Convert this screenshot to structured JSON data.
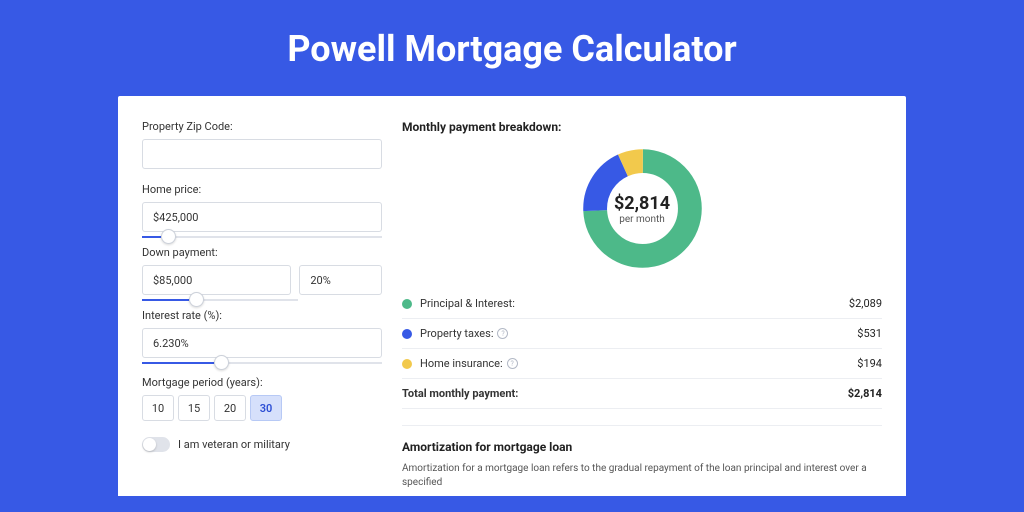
{
  "title": "Powell Mortgage Calculator",
  "form": {
    "zip_label": "Property Zip Code:",
    "zip_value": "",
    "home_price_label": "Home price:",
    "home_price_value": "$425,000",
    "down_payment_label": "Down payment:",
    "down_payment_value": "$85,000",
    "down_payment_pct": "20%",
    "interest_label": "Interest rate (%):",
    "interest_value": "6.230%",
    "period_label": "Mortgage period (years):",
    "periods": [
      "10",
      "15",
      "20",
      "30"
    ],
    "period_active": "30",
    "veteran_label": "I am veteran or military"
  },
  "breakdown": {
    "title": "Monthly payment breakdown:",
    "total_amount": "$2,814",
    "total_sub": "per month",
    "rows": [
      {
        "label": "Principal & Interest:",
        "value": "$2,089",
        "color": "pi"
      },
      {
        "label": "Property taxes:",
        "value": "$531",
        "color": "tax",
        "info": true
      },
      {
        "label": "Home insurance:",
        "value": "$194",
        "color": "ins",
        "info": true
      }
    ],
    "total_label": "Total monthly payment:",
    "total_value": "$2,814"
  },
  "amort": {
    "title": "Amortization for mortgage loan",
    "text": "Amortization for a mortgage loan refers to the gradual repayment of the loan principal and interest over a specified"
  },
  "chart_data": {
    "type": "pie",
    "title": "Monthly payment breakdown",
    "series": [
      {
        "name": "Principal & Interest",
        "value": 2089,
        "color": "#4db989"
      },
      {
        "name": "Property taxes",
        "value": 531,
        "color": "#3759e5"
      },
      {
        "name": "Home insurance",
        "value": 194,
        "color": "#f2c94c"
      }
    ],
    "total": 2814,
    "center_label": "$2,814",
    "center_sub": "per month"
  }
}
